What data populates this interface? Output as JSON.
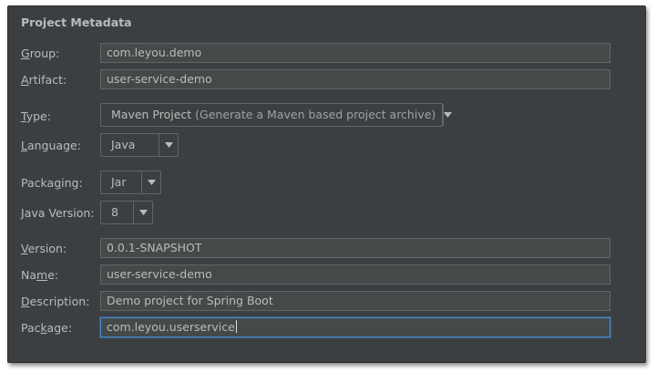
{
  "section_title": "Project Metadata",
  "fields": {
    "group": {
      "label": "Group:",
      "mnemonic": "G",
      "rest": "roup:",
      "value": "com.leyou.demo"
    },
    "artifact": {
      "label": "Artifact:",
      "mnemonic": "A",
      "rest": "rtifact:",
      "value": "user-service-demo"
    },
    "type": {
      "label": "Type:",
      "mnemonic": "T",
      "rest": "ype:",
      "value": "Maven Project",
      "description": " (Generate a Maven based project archive)"
    },
    "language": {
      "label": "Language:",
      "mnemonic": "L",
      "rest": "anguage:",
      "value": "Java"
    },
    "packaging": {
      "label": "Packaging:",
      "pre": "Packa",
      "mnemonic": "g",
      "rest": "ing:",
      "value": "Jar"
    },
    "java_version": {
      "label": "Java Version:",
      "mnemonic": "J",
      "rest": "ava Version:",
      "value": "8"
    },
    "version": {
      "label": "Version:",
      "mnemonic": "V",
      "rest": "ersion:",
      "value": "0.0.1-SNAPSHOT"
    },
    "name": {
      "label": "Name:",
      "pre": "Na",
      "mnemonic": "m",
      "rest": "e:",
      "value": "user-service-demo"
    },
    "description": {
      "label": "Description:",
      "mnemonic": "D",
      "rest": "escription:",
      "value": "Demo project for Spring Boot"
    },
    "package": {
      "label": "Package:",
      "pre": "Pac",
      "mnemonic": "k",
      "rest": "age:",
      "value": "com.leyou.userservice"
    }
  },
  "icons": {
    "dropdown": "chevron-down-icon"
  }
}
